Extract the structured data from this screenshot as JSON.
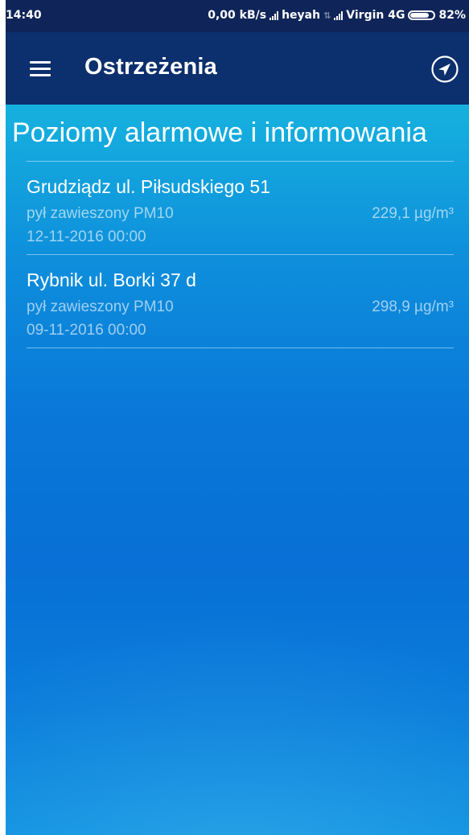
{
  "status_bar": {
    "time": "14:40",
    "network_speed": "0,00 kB/s",
    "carrier1": "heyah",
    "carrier2": "Virgin 4G",
    "battery": "82%",
    "battery_level": 0.82
  },
  "toolbar": {
    "title": "Ostrzeżenia",
    "menu_icon": "hamburger-menu-icon",
    "location_icon": "navigation-arrow-icon"
  },
  "main": {
    "section_title": "Poziomy alarmowe i informowania",
    "alerts": [
      {
        "station": "Grudziądz ul. Piłsudskiego 51",
        "pollutant": "pył zawieszony PM10",
        "value": "229,1 µg/m³",
        "date": "12-11-2016 00:00"
      },
      {
        "station": "Rybnik ul. Borki 37 d",
        "pollutant": "pył zawieszony PM10",
        "value": "298,9 µg/m³",
        "date": "09-11-2016 00:00"
      }
    ]
  },
  "colors": {
    "status_bar_bg": "#0f2559",
    "toolbar_bg": "#0c2f6d",
    "gradient_top": "#16c3d8",
    "gradient_bottom": "#0870d6",
    "text_primary": "#ffffff"
  }
}
